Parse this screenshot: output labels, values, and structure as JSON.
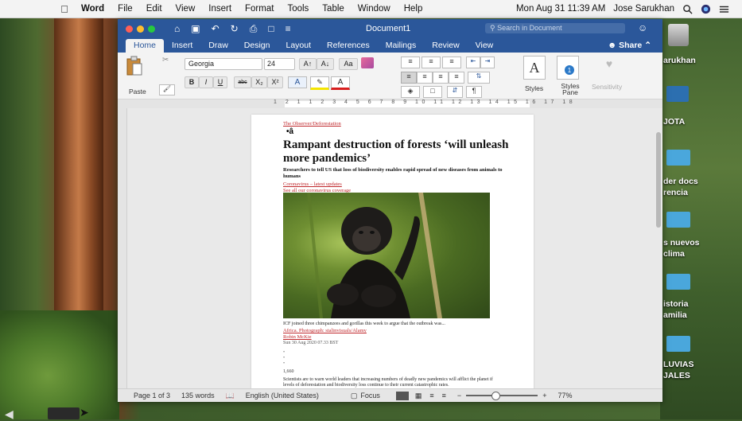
{
  "menubar": {
    "app_name": "Word",
    "items": [
      "File",
      "Edit",
      "View",
      "Insert",
      "Format",
      "Tools",
      "Table",
      "Window",
      "Help"
    ],
    "datetime": "Mon Aug 31  11:39 AM",
    "user": "Jose Sarukhan"
  },
  "titlebar": {
    "document_title": "Document1",
    "search_placeholder": "Search in Document"
  },
  "ribbon_tabs": [
    "Home",
    "Insert",
    "Draw",
    "Design",
    "Layout",
    "References",
    "Mailings",
    "Review",
    "View"
  ],
  "share_label": "Share",
  "ribbon": {
    "paste_label": "Paste",
    "font_name": "Georgia",
    "font_size": "24",
    "styles_label": "Styles",
    "styles_pane_label": "Styles Pane",
    "sensitivity_label": "Sensitivity",
    "bold": "B",
    "italic": "I",
    "underline": "U",
    "strike": "abc",
    "subscript": "X₂",
    "superscript": "X²",
    "grow": "A↑",
    "shrink": "A↓",
    "format_painter": "Aa"
  },
  "ruler_numbers": "1 2 1 1 2 3 4 5 6 7 8 9 10 11 12 13 14 15 16 17 18",
  "document": {
    "top_link": "The Observer/Deforestation",
    "headline": "Rampant destruction of forests ‘will unleash more pandemics’",
    "standfirst": "Researchers to tell US that loss of biodiversity enables rapid spread of new diseases from animals to humans",
    "bullet_1": "Coronavirus – latest updates",
    "bullet_2": "See all our coronavirus coverage",
    "caption": "ICF joined three chimpanzees and gorillas this week to argue that the outbreak was...",
    "caption_link": "Africa. Photograph: stalinvisuals/Alamy",
    "author": "Robin McKie",
    "dateline": "Sun 30 Aug 2020 07.33 BST",
    "shares": "1,660",
    "body": "Scientists are to warn world leaders that increasing numbers of deadly new pandemics will afflict the planet if levels of deforestation and biodiversity loss continue to their current catastrophic rates."
  },
  "statusbar": {
    "page": "Page 1 of 3",
    "words": "135 words",
    "language": "English (United States)",
    "focus": "Focus",
    "zoom": "77%"
  },
  "desktop_labels": [
    "arukhan",
    "JOTA",
    "der docs",
    "rencia",
    "s nuevos",
    "clima",
    "istoria",
    "amilia",
    "LUVIAS",
    "JALES"
  ],
  "colors": {
    "word_blue": "#2b579a",
    "link_red": "#c0282c"
  }
}
